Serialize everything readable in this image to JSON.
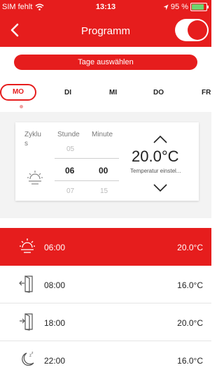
{
  "status_bar": {
    "carrier": "SIM fehlt",
    "time": "13:13",
    "battery": "95 %"
  },
  "header": {
    "title": "Programm",
    "toggle_on": true
  },
  "select_days_label": "Tage auswählen",
  "days": [
    {
      "label": "MO",
      "active": true
    },
    {
      "label": "DI",
      "active": false
    },
    {
      "label": "MI",
      "active": false
    },
    {
      "label": "DO",
      "active": false
    },
    {
      "label": "FR",
      "active": false
    }
  ],
  "editor": {
    "cycle_label_1": "Zyklu",
    "cycle_label_2": "s",
    "hour_label": "Stunde",
    "minute_label": "Minute",
    "hour_prev": "05",
    "hour_current": "06",
    "hour_next": "07",
    "minute_current": "00",
    "minute_next": "15",
    "temperature": "20.0°C",
    "temperature_hint": "Temperatur einstel..."
  },
  "schedule": [
    {
      "icon": "sunrise-icon",
      "time": "06:00",
      "temp": "20.0°C",
      "active": true
    },
    {
      "icon": "door-exit-icon",
      "time": "08:00",
      "temp": "16.0°C",
      "active": false
    },
    {
      "icon": "door-enter-icon",
      "time": "18:00",
      "temp": "20.0°C",
      "active": false
    },
    {
      "icon": "moon-sleep-icon",
      "time": "22:00",
      "temp": "16.0°C",
      "active": false
    }
  ],
  "colors": {
    "accent": "#e61d1d"
  }
}
